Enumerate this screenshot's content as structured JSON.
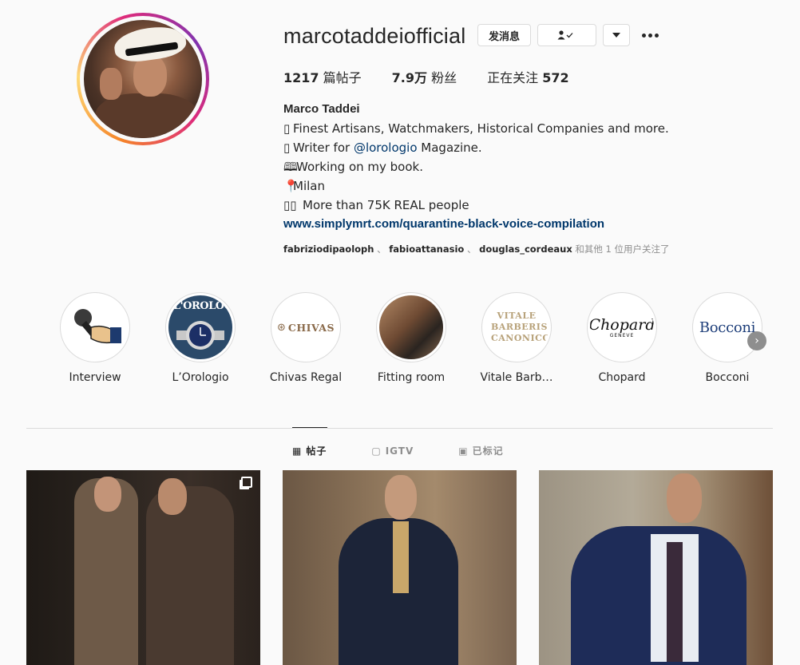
{
  "profile": {
    "username": "marcotaddeiofficial",
    "message_button": "发消息",
    "following_icon": "person-check-icon",
    "dropdown_icon": "caret-down-icon",
    "more_icon": "more-dots-icon"
  },
  "stats": {
    "posts_count": "1217",
    "posts_label": "篇帖子",
    "followers_count": "7.9万",
    "followers_label": "粉丝",
    "following_label": "正在关注",
    "following_count": "572"
  },
  "bio": {
    "name": "Marco Taddei",
    "line1": "Finest Artisans, Watchmakers, Historical Companies and more.",
    "line2_prefix": "Writer for ",
    "line2_mention": "@lorologio",
    "line2_suffix": " Magazine.",
    "line3": "Working on my book.",
    "line4": "Milan",
    "line5": "More than 75K REAL people",
    "link": "www.simplymrt.com/quarantine-black-voice-compilation"
  },
  "followed_by": {
    "account1": "fabriziodipaoloph",
    "sep": "、",
    "account2": "fabioattanasio",
    "account3": "douglas_cordeaux",
    "suffix": "和其他 1 位用户关注了"
  },
  "highlights": [
    {
      "label": "Interview",
      "logo": ""
    },
    {
      "label": "L’Orologio",
      "logo": "L'OROLOGIO"
    },
    {
      "label": "Chivas Regal",
      "logo": "CHIVAS"
    },
    {
      "label": "Fitting room",
      "logo": ""
    },
    {
      "label": "Vitale Barb…",
      "logo": "VITALE BARBERIS CANONICO"
    },
    {
      "label": "Chopard",
      "logo": "Chopard",
      "sublogo": "GENEVE"
    },
    {
      "label": "Bocconi",
      "logo": "Bocconi"
    }
  ],
  "tabs": [
    {
      "label": "帖子",
      "icon": "grid-icon",
      "active": true
    },
    {
      "label": "IGTV",
      "icon": "igtv-icon",
      "active": false
    },
    {
      "label": "已标记",
      "icon": "tagged-icon",
      "active": false
    }
  ],
  "colors": {
    "link": "#00376b",
    "muted": "#8e8e8e",
    "border": "#dbdbdb",
    "text": "#262626"
  }
}
